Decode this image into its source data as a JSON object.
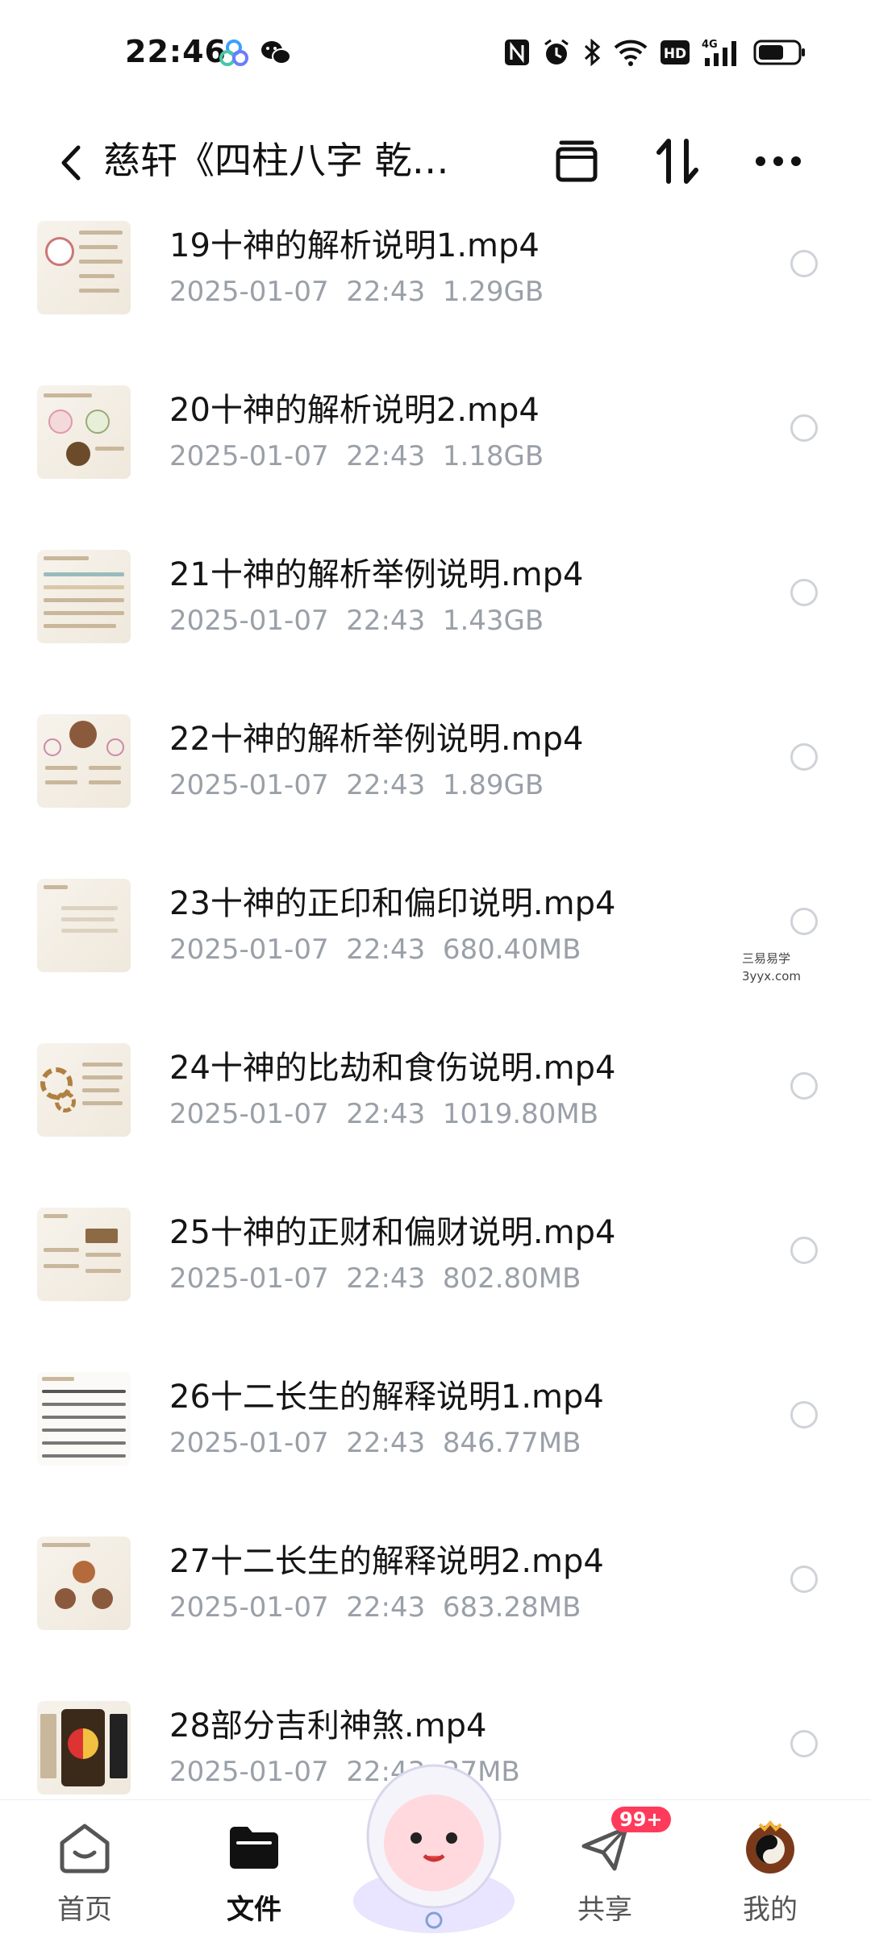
{
  "status_bar": {
    "time": "22:46",
    "right_icons": [
      "nfc-icon",
      "alarm-icon",
      "bluetooth-icon",
      "wifi-icon",
      "hd-icon",
      "4g-signal-icon",
      "battery-icon"
    ],
    "hd_label": "HD",
    "network_label": "4G"
  },
  "header": {
    "title": "慈轩《四柱八字 乾…"
  },
  "files": [
    {
      "name": "19十神的解析说明1.mp4",
      "date": "2025-01-07",
      "time": "22:43",
      "size": "1.29GB"
    },
    {
      "name": "20十神的解析说明2.mp4",
      "date": "2025-01-07",
      "time": "22:43",
      "size": "1.18GB"
    },
    {
      "name": "21十神的解析举例说明.mp4",
      "date": "2025-01-07",
      "time": "22:43",
      "size": "1.43GB"
    },
    {
      "name": "22十神的解析举例说明.mp4",
      "date": "2025-01-07",
      "time": "22:43",
      "size": "1.89GB"
    },
    {
      "name": "23十神的正印和偏印说明.mp4",
      "date": "2025-01-07",
      "time": "22:43",
      "size": "680.40MB"
    },
    {
      "name": "24十神的比劫和食伤说明.mp4",
      "date": "2025-01-07",
      "time": "22:43",
      "size": "1019.80MB"
    },
    {
      "name": "25十神的正财和偏财说明.mp4",
      "date": "2025-01-07",
      "time": "22:43",
      "size": "802.80MB"
    },
    {
      "name": "26十二长生的解释说明1.mp4",
      "date": "2025-01-07",
      "time": "22:43",
      "size": "846.77MB"
    },
    {
      "name": "27十二长生的解释说明2.mp4",
      "date": "2025-01-07",
      "time": "22:43",
      "size": "683.28MB"
    },
    {
      "name": "28部分吉利神煞.mp4",
      "date": "2025-01-07",
      "time": "22:43",
      "size": "27MB"
    }
  ],
  "watermark": {
    "line1": "三易易学",
    "line2": "3yyx.com"
  },
  "tabbar": {
    "tabs": [
      {
        "label": "首页",
        "icon": "home-icon",
        "active": false
      },
      {
        "label": "文件",
        "icon": "folder-icon",
        "active": true
      },
      {
        "label": "共享",
        "icon": "share-icon",
        "active": false,
        "badge": "99+"
      },
      {
        "label": "我的",
        "icon": "avatar-icon",
        "active": false
      }
    ]
  },
  "colors": {
    "meta_gray": "#9aa0a8",
    "badge_red": "#ff3b5c",
    "thumb_beige": "#f2ece2"
  }
}
